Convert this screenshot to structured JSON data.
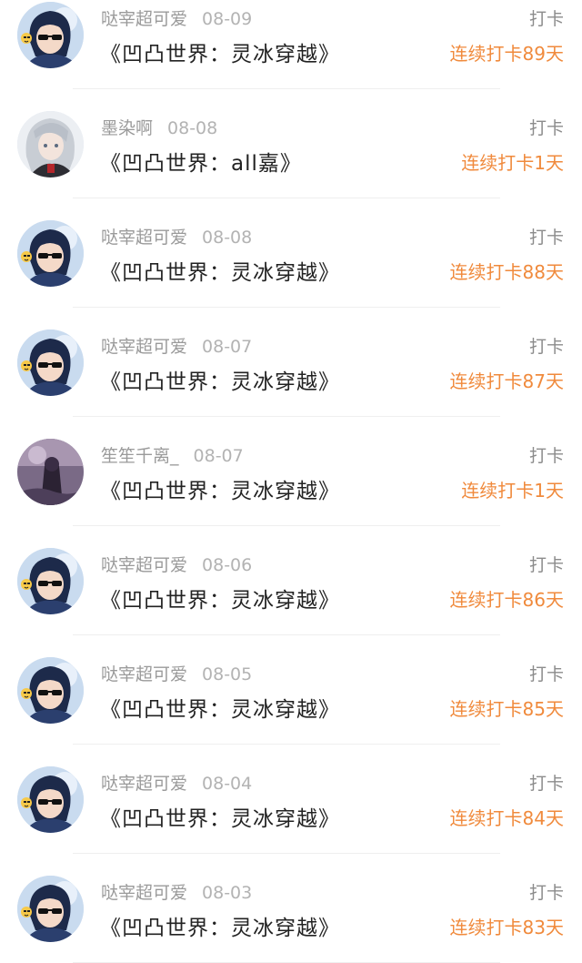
{
  "feed": {
    "items": [
      {
        "user": "哒宰超可爱",
        "date": "08-09",
        "book": "《凹凸世界：灵冰穿越》",
        "tag": "打卡",
        "streak": "连续打卡89天",
        "avatar": "dark-hair-sunglasses"
      },
      {
        "user": "墨染啊",
        "date": "08-08",
        "book": "《凹凸世界：all嘉》",
        "tag": "打卡",
        "streak": "连续打卡1天",
        "avatar": "silver-hair"
      },
      {
        "user": "哒宰超可爱",
        "date": "08-08",
        "book": "《凹凸世界：灵冰穿越》",
        "tag": "打卡",
        "streak": "连续打卡88天",
        "avatar": "dark-hair-sunglasses"
      },
      {
        "user": "哒宰超可爱",
        "date": "08-07",
        "book": "《凹凸世界：灵冰穿越》",
        "tag": "打卡",
        "streak": "连续打卡87天",
        "avatar": "dark-hair-sunglasses"
      },
      {
        "user": "笙笙千离_",
        "date": "08-07",
        "book": "《凹凸世界：灵冰穿越》",
        "tag": "打卡",
        "streak": "连续打卡1天",
        "avatar": "purple-scene"
      },
      {
        "user": "哒宰超可爱",
        "date": "08-06",
        "book": "《凹凸世界：灵冰穿越》",
        "tag": "打卡",
        "streak": "连续打卡86天",
        "avatar": "dark-hair-sunglasses"
      },
      {
        "user": "哒宰超可爱",
        "date": "08-05",
        "book": "《凹凸世界：灵冰穿越》",
        "tag": "打卡",
        "streak": "连续打卡85天",
        "avatar": "dark-hair-sunglasses"
      },
      {
        "user": "哒宰超可爱",
        "date": "08-04",
        "book": "《凹凸世界：灵冰穿越》",
        "tag": "打卡",
        "streak": "连续打卡84天",
        "avatar": "dark-hair-sunglasses"
      },
      {
        "user": "哒宰超可爱",
        "date": "08-03",
        "book": "《凹凸世界：灵冰穿越》",
        "tag": "打卡",
        "streak": "连续打卡83天",
        "avatar": "dark-hair-sunglasses"
      }
    ]
  },
  "colors": {
    "streak": "#f08a3c",
    "username": "#9a9a9a",
    "title": "#222222",
    "tag": "#8c8c8c"
  }
}
